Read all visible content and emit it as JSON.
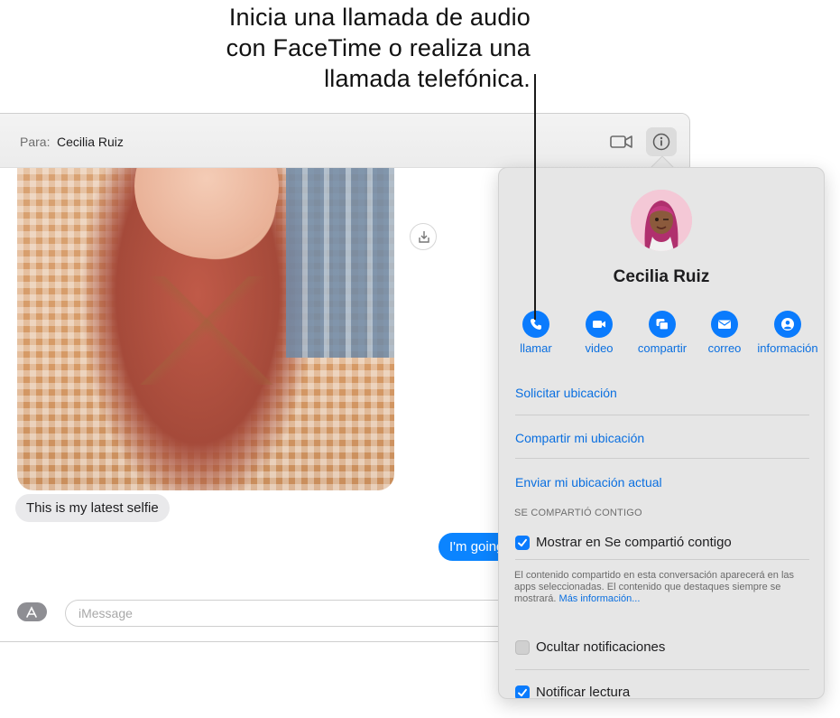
{
  "callout": {
    "line1": "Inicia una llamada de audio",
    "line2": "con FaceTime o realiza una",
    "line3": "llamada telefónica."
  },
  "header": {
    "to_label": "Para:",
    "recipient": "Cecilia Ruiz"
  },
  "conversation": {
    "incoming_message": "This is my latest selfie",
    "outgoing_message": "I'm going",
    "input_placeholder": "iMessage"
  },
  "panel": {
    "contact_name": "Cecilia Ruiz",
    "actions": [
      {
        "label": "llamar",
        "icon": "phone-icon"
      },
      {
        "label": "video",
        "icon": "video-icon"
      },
      {
        "label": "compartir",
        "icon": "share-screen-icon"
      },
      {
        "label": "correo",
        "icon": "mail-icon"
      },
      {
        "label": "información",
        "icon": "person-icon"
      }
    ],
    "request_location": "Solicitar ubicación",
    "share_location": "Compartir mi ubicación",
    "send_location": "Enviar mi ubicación actual",
    "shared_section": "SE COMPARTIÓ CONTIGO",
    "show_shared": {
      "label": "Mostrar en Se compartió contigo",
      "checked": true
    },
    "shared_description": "El contenido compartido en esta conversación aparecerá en las apps seleccionadas. El contenido que destaques siempre se mostrará.",
    "more_info": "Más información...",
    "hide_alerts": {
      "label": "Ocultar notificaciones",
      "checked": false
    },
    "read_receipts": {
      "label": "Notificar lectura",
      "checked": true
    }
  },
  "colors": {
    "accent": "#0a7bfd",
    "outgoing_bubble": "#0b84ff",
    "incoming_bubble": "#e9e9eb",
    "panel_bg": "#e6e6e6"
  }
}
